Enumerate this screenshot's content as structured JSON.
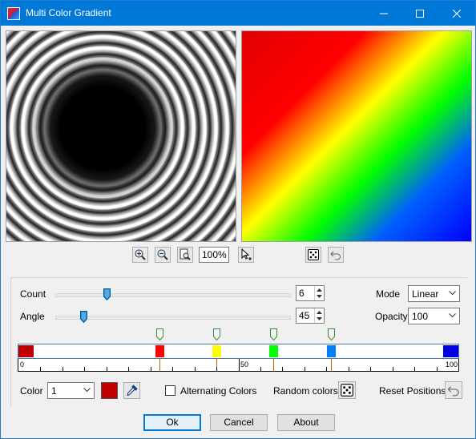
{
  "window": {
    "title": "Multi Color Gradient",
    "minimize_glyph": "—",
    "maximize_glyph": "☐",
    "close_glyph": "✕"
  },
  "toolbar": {
    "zoom_value": "100%"
  },
  "settings": {
    "count_label": "Count",
    "count_value": "6",
    "count_slider_fraction": 0.22,
    "angle_label": "Angle",
    "angle_value": "45",
    "angle_slider_fraction": 0.12,
    "mode_label": "Mode",
    "mode_value": "Linear",
    "opacity_label": "Opacity",
    "opacity_value": "100"
  },
  "gradient": {
    "stops": [
      {
        "position": 0,
        "color": "#c00000"
      },
      {
        "position": 32,
        "color": "#ff0000"
      },
      {
        "position": 45,
        "color": "#ffff00"
      },
      {
        "position": 58,
        "color": "#00ff00"
      },
      {
        "position": 71,
        "color": "#0080ff"
      },
      {
        "position": 100,
        "color": "#0000e0"
      }
    ],
    "ruler_labels": [
      "0",
      "50",
      "100"
    ]
  },
  "color_row": {
    "color_label": "Color",
    "color_index": "1",
    "swatch_color": "#c00000",
    "alternating_label": "Alternating Colors",
    "alternating_checked": false,
    "random_label": "Random colors",
    "reset_label": "Reset Positions"
  },
  "buttons": {
    "ok": "Ok",
    "cancel": "Cancel",
    "about": "About"
  }
}
